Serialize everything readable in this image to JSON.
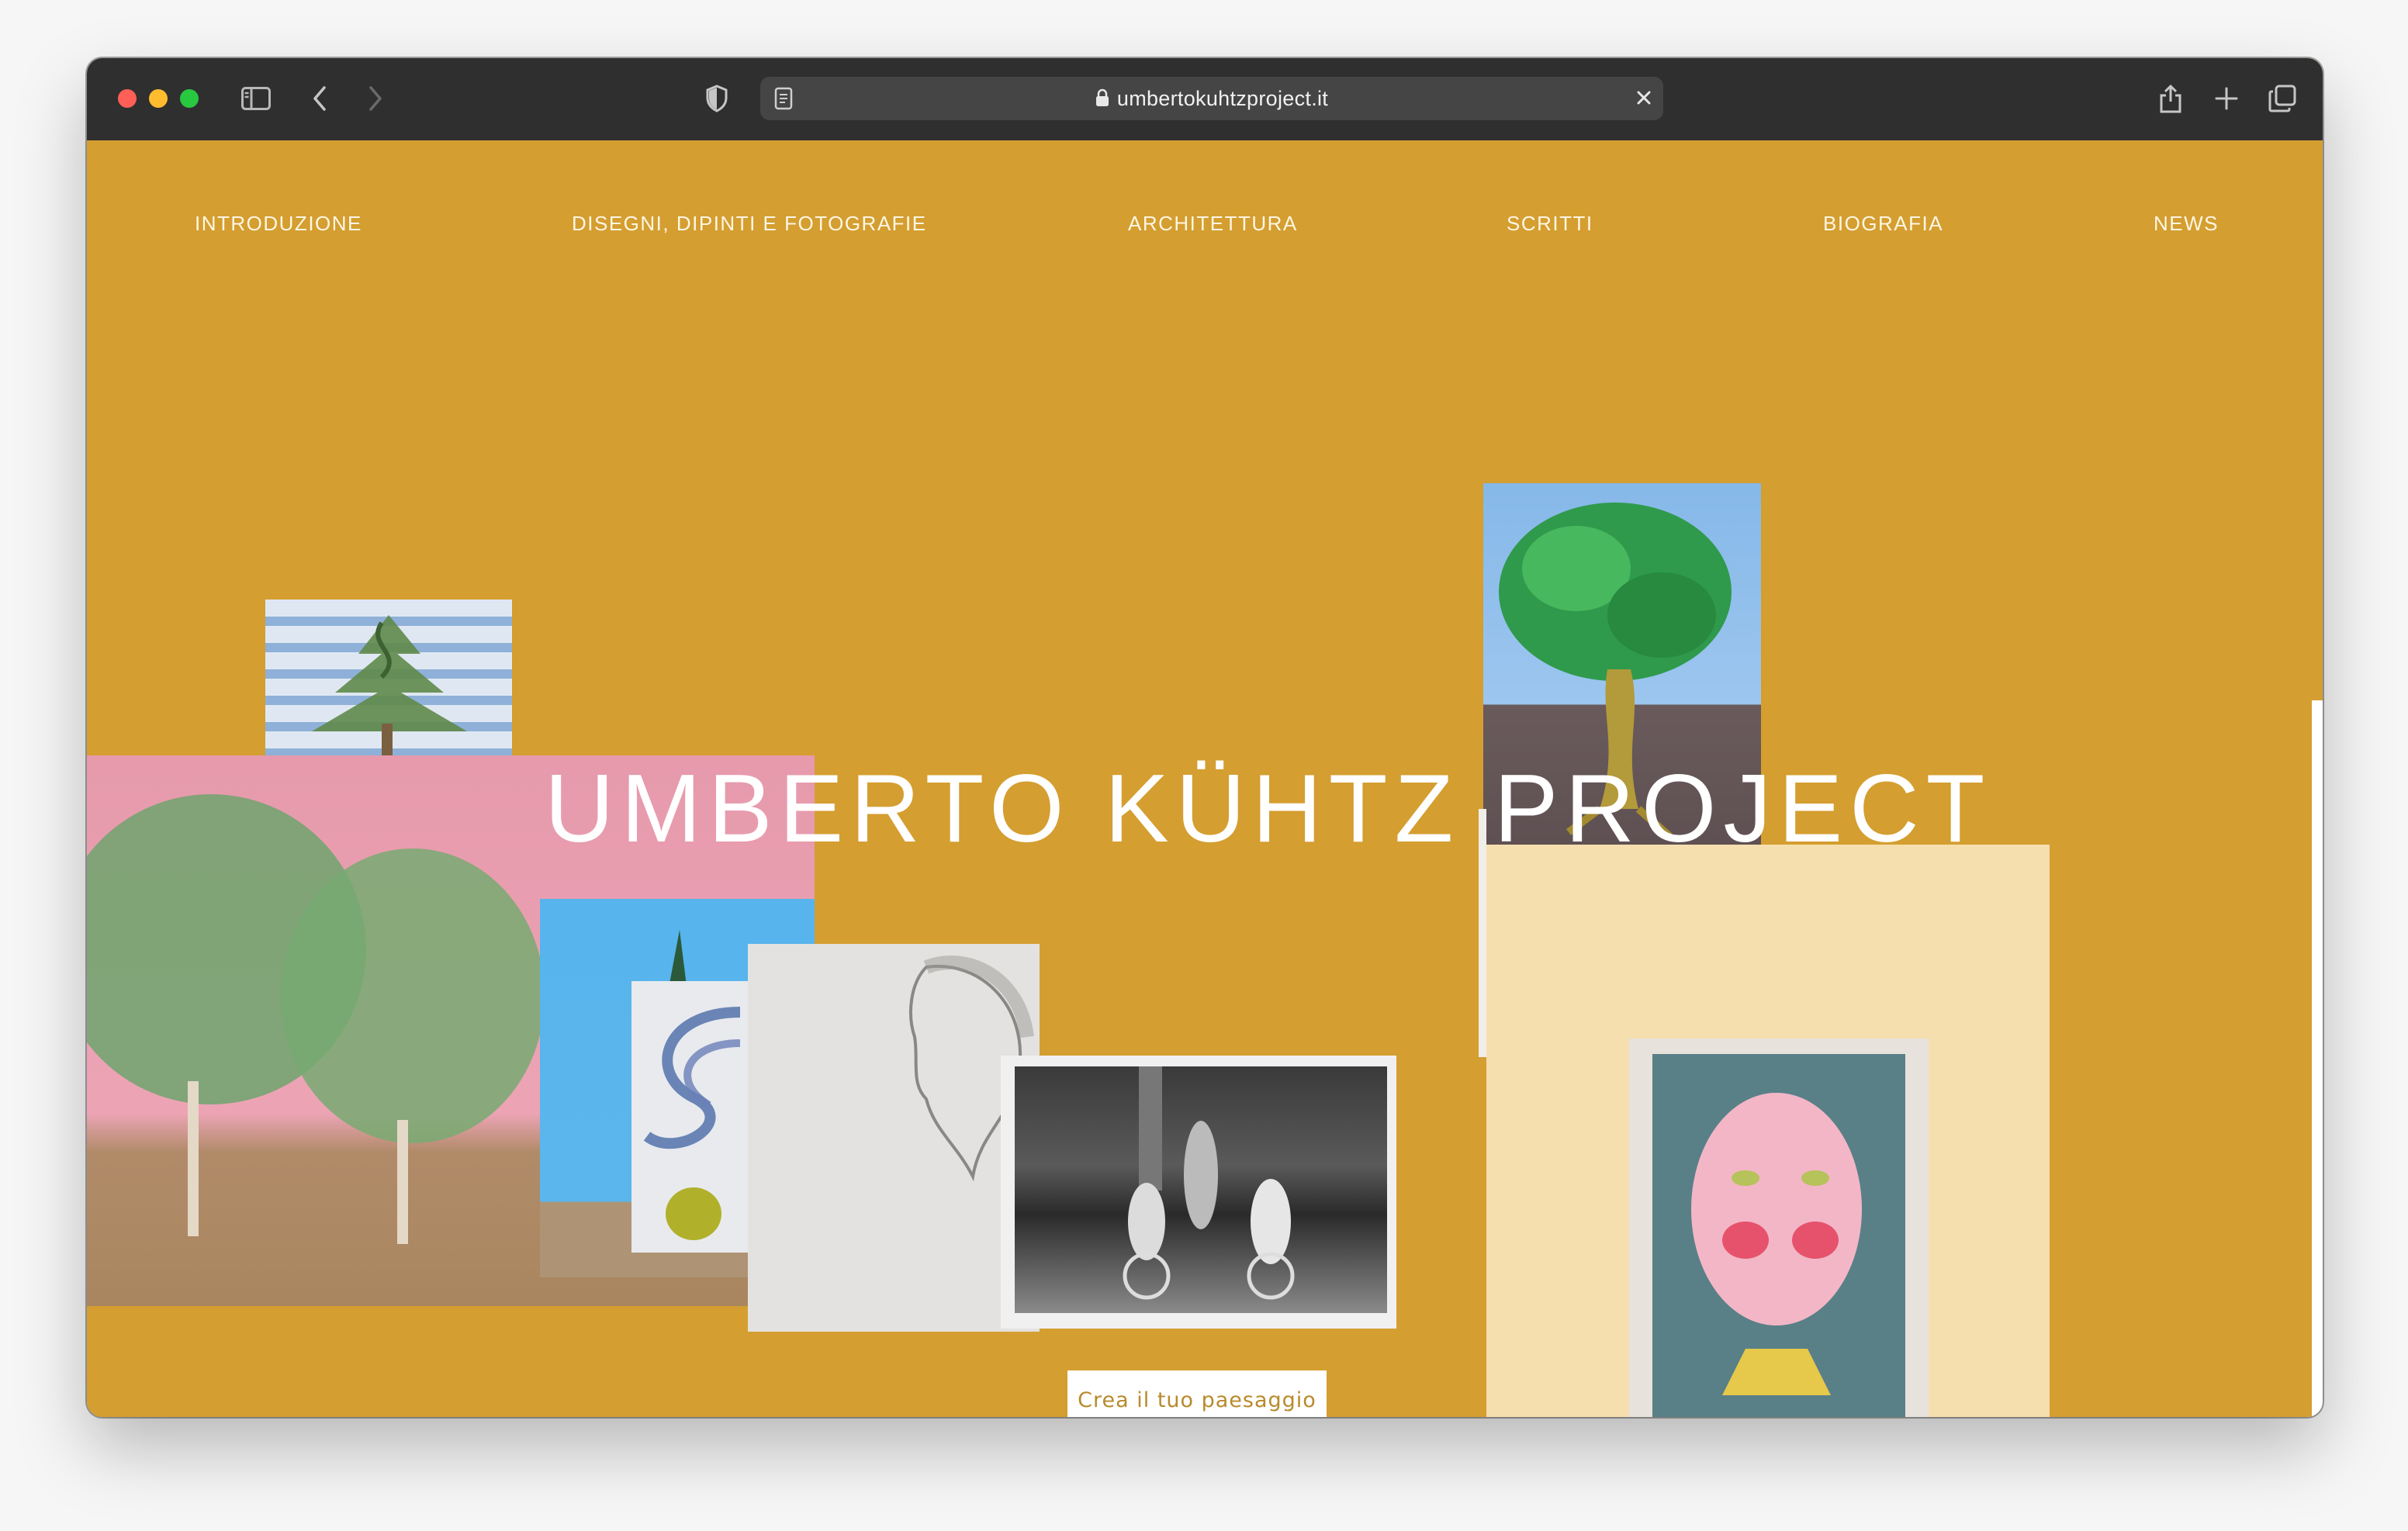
{
  "browser": {
    "url": "umbertokuhtzproject.it"
  },
  "nav": {
    "items": [
      {
        "label": "INTRODUZIONE"
      },
      {
        "label": "DISEGNI, DIPINTI E FOTOGRAFIE"
      },
      {
        "label": "ARCHITETTURA"
      },
      {
        "label": "SCRITTI"
      },
      {
        "label": "BIOGRAFIA"
      },
      {
        "label": "NEWS"
      }
    ]
  },
  "hero": {
    "title": "UMBERTO KÜHTZ PROJECT",
    "cta_label": "Crea il tuo paesaggio"
  },
  "colors": {
    "background": "#d49e30",
    "toolbar": "#2f2f2f",
    "cta_text": "#b88a2c"
  }
}
